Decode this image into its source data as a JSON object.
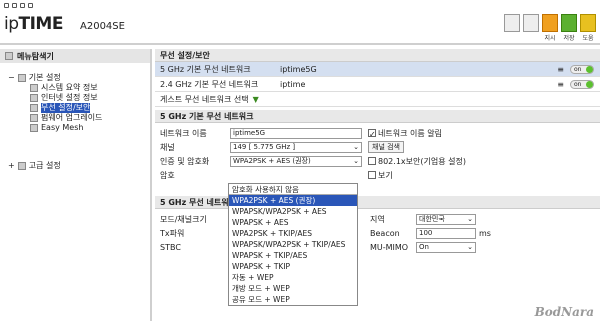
{
  "header": {
    "logo_prefix": "ip",
    "logo_main": "TIME",
    "model": "A2004SE",
    "icon_labels": [
      "지시",
      "저장",
      "도움"
    ]
  },
  "sidebar": {
    "title": "메뉴탐색기",
    "groups": [
      {
        "label": "기본 설정",
        "items": [
          "시스템 요약 정보",
          "인터넷 설정 정보",
          "무선 설정/보안",
          "펌웨어 업그레이드",
          "Easy Mesh"
        ]
      },
      {
        "label": "고급 설정",
        "items": []
      }
    ]
  },
  "main": {
    "section1": "무선 설정/보안",
    "networks": [
      {
        "label": "5 GHz 기본 무선 네트워크",
        "ssid": "iptime5G",
        "toggle": "on"
      },
      {
        "label": "2.4 GHz 기본 무선 네트워크",
        "ssid": "iptime",
        "toggle": "on"
      }
    ],
    "guest": "게스트 무선 네트워크 선택",
    "section2": "5 GHz 기본 무선 네트워크",
    "form": {
      "name_label": "네트워크 이름",
      "name_value": "iptime5G",
      "name_alert": "네트워크 이름 알림",
      "channel_label": "채널",
      "channel_value": "149 [ 5.775 GHz ]",
      "channel_search": "채널 검색",
      "auth_label": "인증 및 암호화",
      "auth_value": "WPA2PSK + AES (권장)",
      "opt_8021x": "802.1x보안(기업용 설정)",
      "pw_label": "암호",
      "pw_show": "보기"
    },
    "section3": "5 GHz 무선 네트워",
    "adv": {
      "mode_label": "모드/채널크기",
      "region_label": "지역",
      "region_value": "대한민국",
      "tx_label": "Tx파워",
      "beacon_label": "Beacon",
      "beacon_value": "100",
      "beacon_unit": "ms",
      "stbc_label": "STBC",
      "mumimo_label": "MU-MIMO",
      "mumimo_value": "On"
    }
  },
  "dropdown": {
    "options": [
      "암호화 사용하지 않음",
      "WPA2PSK + AES (권장)",
      "WPAPSK/WPA2PSK + AES",
      "WPAPSK + AES",
      "WPA2PSK + TKIP/AES",
      "WPAPSK/WPA2PSK + TKIP/AES",
      "WPAPSK + TKIP/AES",
      "WPAPSK + TKIP",
      "자동 + WEP",
      "개방 모드 + WEP",
      "공유 모드 + WEP"
    ],
    "selected_index": 1
  },
  "watermark": "BodNara"
}
